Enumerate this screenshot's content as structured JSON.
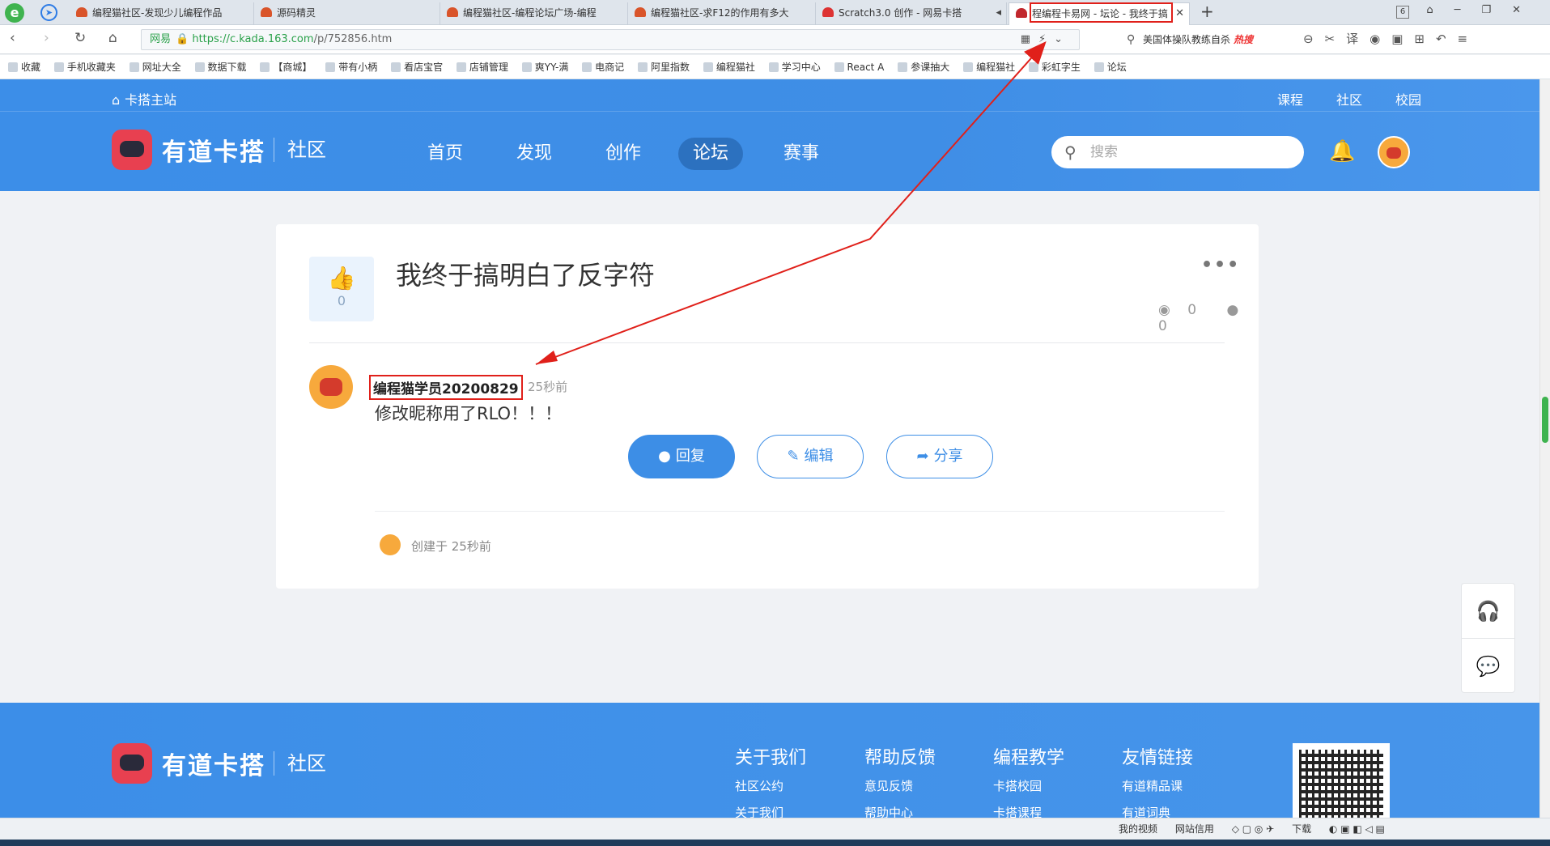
{
  "browser": {
    "tabs": [
      {
        "title": "编程猫社区-发现少儿编程作品"
      },
      {
        "title": "源码精灵"
      },
      {
        "title": "编程猫社区-编程论坛广场-编程"
      },
      {
        "title": "编程猫社区-求F12的作用有多大"
      },
      {
        "title": "Scratch3.0 创作 - 网易卡搭"
      },
      {
        "title": "程编程卡易网 - 坛论 - 我终于搞",
        "active": true
      }
    ],
    "tab_count": "6",
    "url_security": "网易",
    "url_host": "https://c.kada.163.com",
    "url_path": "/p/752856.htm",
    "search_text": "美国体操队教练自杀",
    "search_hot": "热搜",
    "bookmarks": [
      "收藏",
      "手机收藏夹",
      "网址大全",
      "数据下载",
      "【商城】",
      "带有小柄",
      "看店宝官",
      "店铺管理",
      "爽YY-满",
      "电商记",
      "阿里指数",
      "编程猫社",
      "学习中心",
      "React A",
      "参课抽大",
      "编程猫社",
      "彩虹字生",
      "论坛"
    ]
  },
  "site": {
    "home_link": "卡搭主站",
    "top_links": [
      "课程",
      "社区",
      "校园"
    ],
    "brand_name": "有道卡搭",
    "brand_sub": "社区",
    "nav": [
      {
        "label": "首页"
      },
      {
        "label": "发现"
      },
      {
        "label": "创作"
      },
      {
        "label": "论坛",
        "active": true
      },
      {
        "label": "赛事"
      }
    ],
    "search_placeholder": "搜索"
  },
  "post": {
    "like_count": "0",
    "title": "我终于搞明白了反字符",
    "views": "0",
    "comments": "0",
    "author": "编程猫学员20200829",
    "time": "25秒前",
    "content": "修改昵称用了RLO！！！",
    "actions": {
      "reply": "回复",
      "edit": "编辑",
      "share": "分享"
    },
    "created": "创建于 25秒前"
  },
  "footer": {
    "brand_name": "有道卡搭",
    "brand_sub": "社区",
    "columns": [
      {
        "title": "关于我们",
        "items": [
          "社区公约",
          "关于我们"
        ]
      },
      {
        "title": "帮助反馈",
        "items": [
          "意见反馈",
          "帮助中心"
        ]
      },
      {
        "title": "编程教学",
        "items": [
          "卡搭校园",
          "卡搭课程"
        ]
      },
      {
        "title": "友情链接",
        "items": [
          "有道精品课",
          "有道词典"
        ]
      }
    ]
  },
  "statusbar": {
    "items": [
      "我的视频",
      "网站信用",
      "下载"
    ]
  },
  "colors": {
    "primary": "#3d8ee6",
    "annotation": "#e0201a"
  }
}
